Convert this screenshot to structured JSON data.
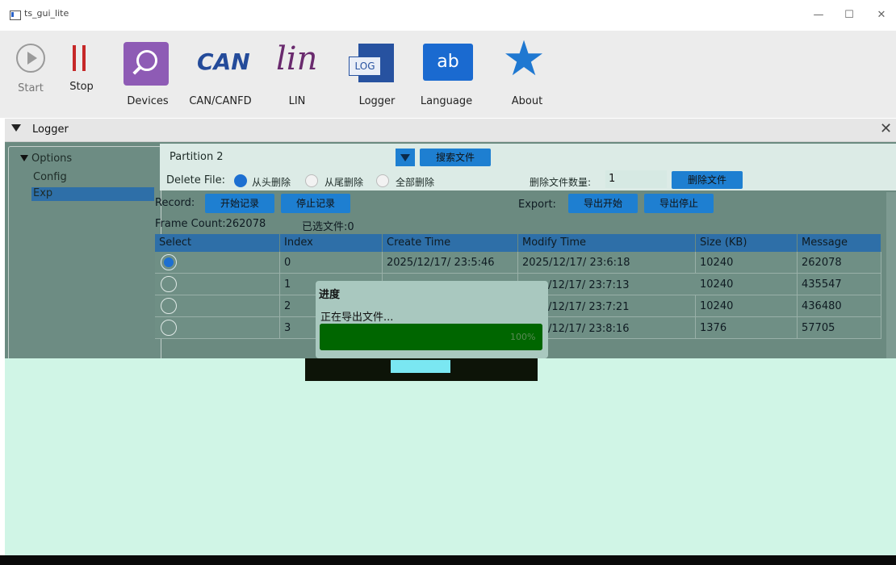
{
  "window": {
    "title": "ts_gui_lite",
    "minimize": "—",
    "maximize": "☐",
    "close": "✕"
  },
  "toolbar": {
    "start_label": "Start",
    "stop_label": "Stop",
    "devices_label": "Devices",
    "can_label": "CAN/CANFD",
    "can_logo": "CAN",
    "lin_label": "LIN",
    "lin_logo": "lin",
    "logger_label": "Logger",
    "logger_logo": "LOG",
    "language_label": "Language",
    "language_logo": "ab",
    "about_label": "About",
    "colors": {
      "devices": "#8e5bb5",
      "can": "#244b9a",
      "lin": "#6a2a6e",
      "language": "#1a6ad0",
      "about": "#1f78d1",
      "stop": "#c62828"
    }
  },
  "logger": {
    "title": "Logger",
    "close": "✕"
  },
  "options": {
    "title": "Options",
    "items": [
      "Config",
      "Exp"
    ]
  },
  "controls": {
    "partition_value": "Partition 2",
    "search_button": "搜索文件",
    "delete_file_label": "Delete File:",
    "delete_modes": [
      "从头删除",
      "从尾删除",
      "全部删除"
    ],
    "delete_count_label": "删除文件数量:",
    "delete_count_value": "1",
    "delete_button": "删除文件",
    "record_label": "Record:",
    "record_start": "开始记录",
    "record_stop": "停止记录",
    "export_label": "Export:",
    "export_start": "导出开始",
    "export_stop": "导出停止",
    "frame_count": "Frame Count:262078",
    "selected_files": "已选文件:0"
  },
  "table": {
    "headers": [
      "Select",
      "Index",
      "Create Time",
      "Modify Time",
      "Size (KB)",
      "Message Count"
    ],
    "rows": [
      {
        "selected": true,
        "index": "0",
        "create": "2025/12/17/ 23:5:46",
        "modify": "2025/12/17/ 23:6:18",
        "size": "10240",
        "count": "262078"
      },
      {
        "selected": false,
        "index": "1",
        "create": "",
        "modify": "/12/17/ 23:7:13",
        "size": "10240",
        "count": "435547"
      },
      {
        "selected": false,
        "index": "2",
        "create": "",
        "modify": "/12/17/ 23:7:21",
        "size": "10240",
        "count": "436480"
      },
      {
        "selected": false,
        "index": "3",
        "create": "",
        "modify": "/12/17/ 23:8:16",
        "size": "1376",
        "count": "57705"
      }
    ]
  },
  "dialog": {
    "title": "进度",
    "message": "正在导出文件...",
    "progress_text": "100%",
    "progress_value": 1.0
  }
}
